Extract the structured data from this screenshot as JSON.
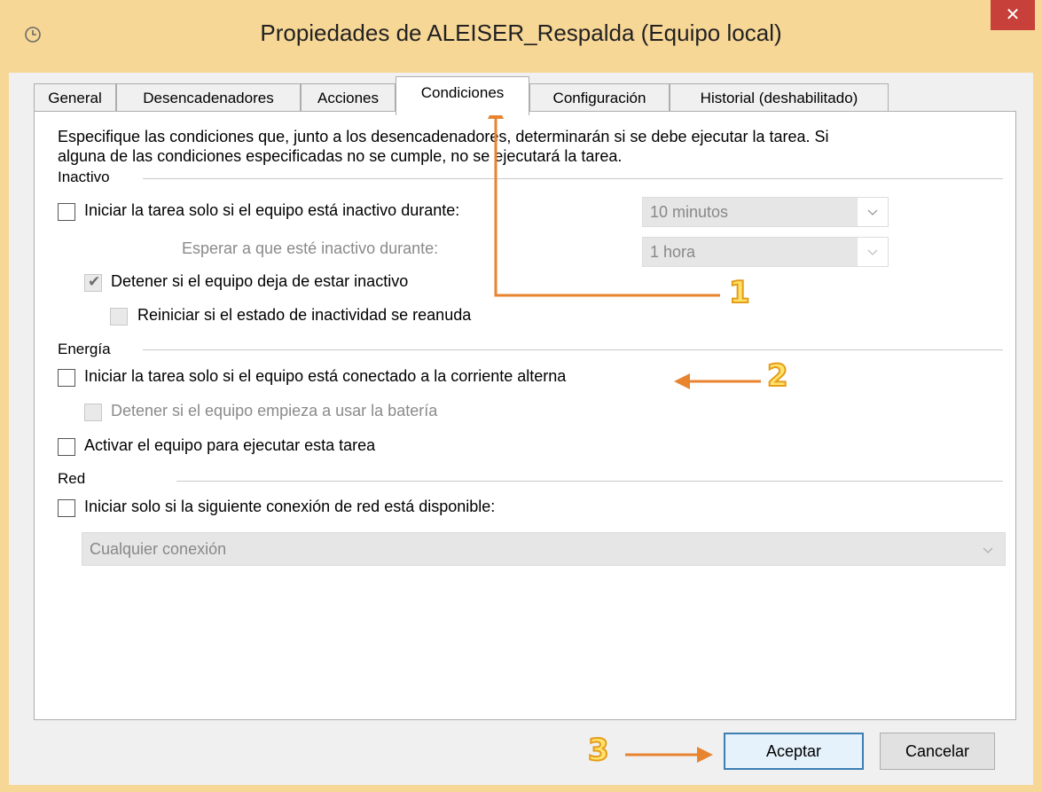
{
  "window": {
    "title": "Propiedades de ALEISER_Respalda (Equipo local)",
    "close_glyph": "✕",
    "frame_color": "#f7d796"
  },
  "tabs": [
    {
      "label": "General",
      "active": false
    },
    {
      "label": "Desencadenadores",
      "active": false
    },
    {
      "label": "Acciones",
      "active": false
    },
    {
      "label": "Condiciones",
      "active": true
    },
    {
      "label": "Configuración",
      "active": false
    },
    {
      "label": "Historial (deshabilitado)",
      "active": false
    }
  ],
  "intro": {
    "line1": "Especifique las condiciones que, junto a los desencadenadores, determinarán si se debe ejecutar la tarea. Si",
    "line2": "alguna de las condiciones especificadas no se cumple, no se ejecutará la tarea."
  },
  "inactivo": {
    "heading": "Inactivo",
    "start_idle": {
      "label": "Iniciar la tarea solo si el equipo está inactivo durante:",
      "checked": false
    },
    "idle_duration": {
      "value": "10 minutos"
    },
    "wait_label": "Esperar a que esté inactivo durante:",
    "wait_duration": {
      "value": "1 hora"
    },
    "stop_idle": {
      "label": "Detener si el equipo deja de estar inactivo",
      "checked": true
    },
    "restart_idle": {
      "label": "Reiniciar si el estado de inactividad se reanuda",
      "checked": false
    }
  },
  "energia": {
    "heading": "Energía",
    "ac_power": {
      "label": "Iniciar la tarea solo si el equipo está conectado a la corriente alterna",
      "checked": false
    },
    "stop_battery": {
      "label": "Detener si el equipo empieza a usar la batería",
      "checked": false
    },
    "wake": {
      "label": "Activar el equipo para ejecutar esta tarea",
      "checked": false
    }
  },
  "red": {
    "heading": "Red",
    "network": {
      "label": "Iniciar solo si la siguiente conexión de red está disponible:",
      "checked": false
    },
    "connection": {
      "value": "Cualquier conexión"
    }
  },
  "buttons": {
    "ok": "Aceptar",
    "cancel": "Cancelar"
  },
  "annotations": {
    "n1": "1",
    "n2": "2",
    "n3": "3",
    "arrow_color": "#e8832f"
  }
}
